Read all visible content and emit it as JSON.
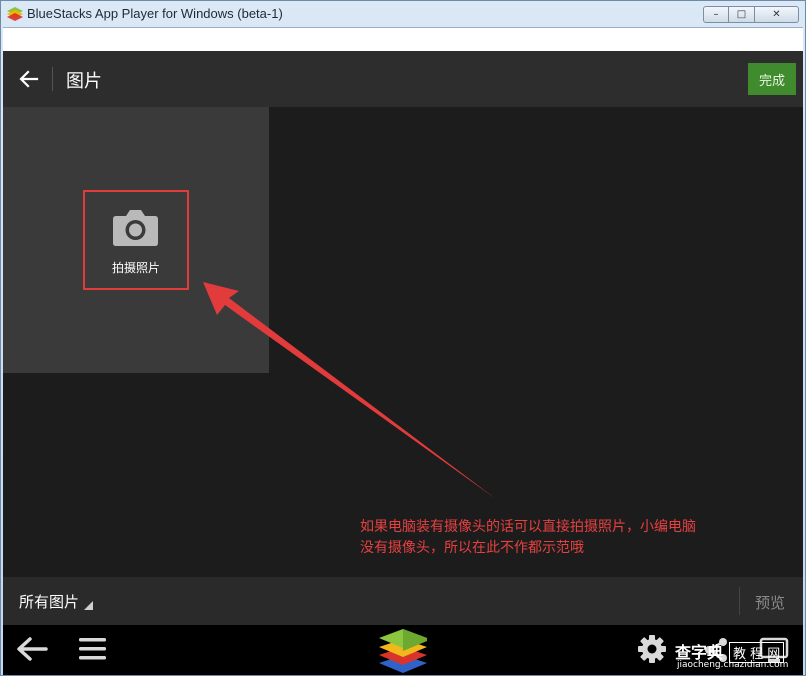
{
  "window": {
    "title": "BlueStacks App Player for Windows (beta-1)",
    "minimize_symbol": "–",
    "maximize_symbol": "□",
    "close_symbol": "✕"
  },
  "action_bar": {
    "back_icon": "back-arrow-icon",
    "title": "图片",
    "done_label": "完成",
    "done_color": "#3f8b2e"
  },
  "capture_tile": {
    "icon": "camera-icon",
    "label": "拍摄照片",
    "highlight_color": "#e23b3b"
  },
  "annotation": {
    "lines": [
      "如果电脑装有摄像头的话可以直接拍摄照片，小编电脑",
      "没有摄像头，所以在此不作都示范哦"
    ],
    "color": "#e64040"
  },
  "bottom_bar": {
    "album_label": "所有图片",
    "preview_label": "预览"
  },
  "nav_bar": {
    "icons": [
      "back-arrow-icon",
      "menu-icon",
      "bluestacks-logo-icon",
      "settings-icon",
      "share-icon",
      "fullscreen-icon"
    ]
  },
  "watermark": {
    "text": "查字典",
    "box_text": "教 程 网",
    "url": "jiaocheng.chazidian.com"
  }
}
